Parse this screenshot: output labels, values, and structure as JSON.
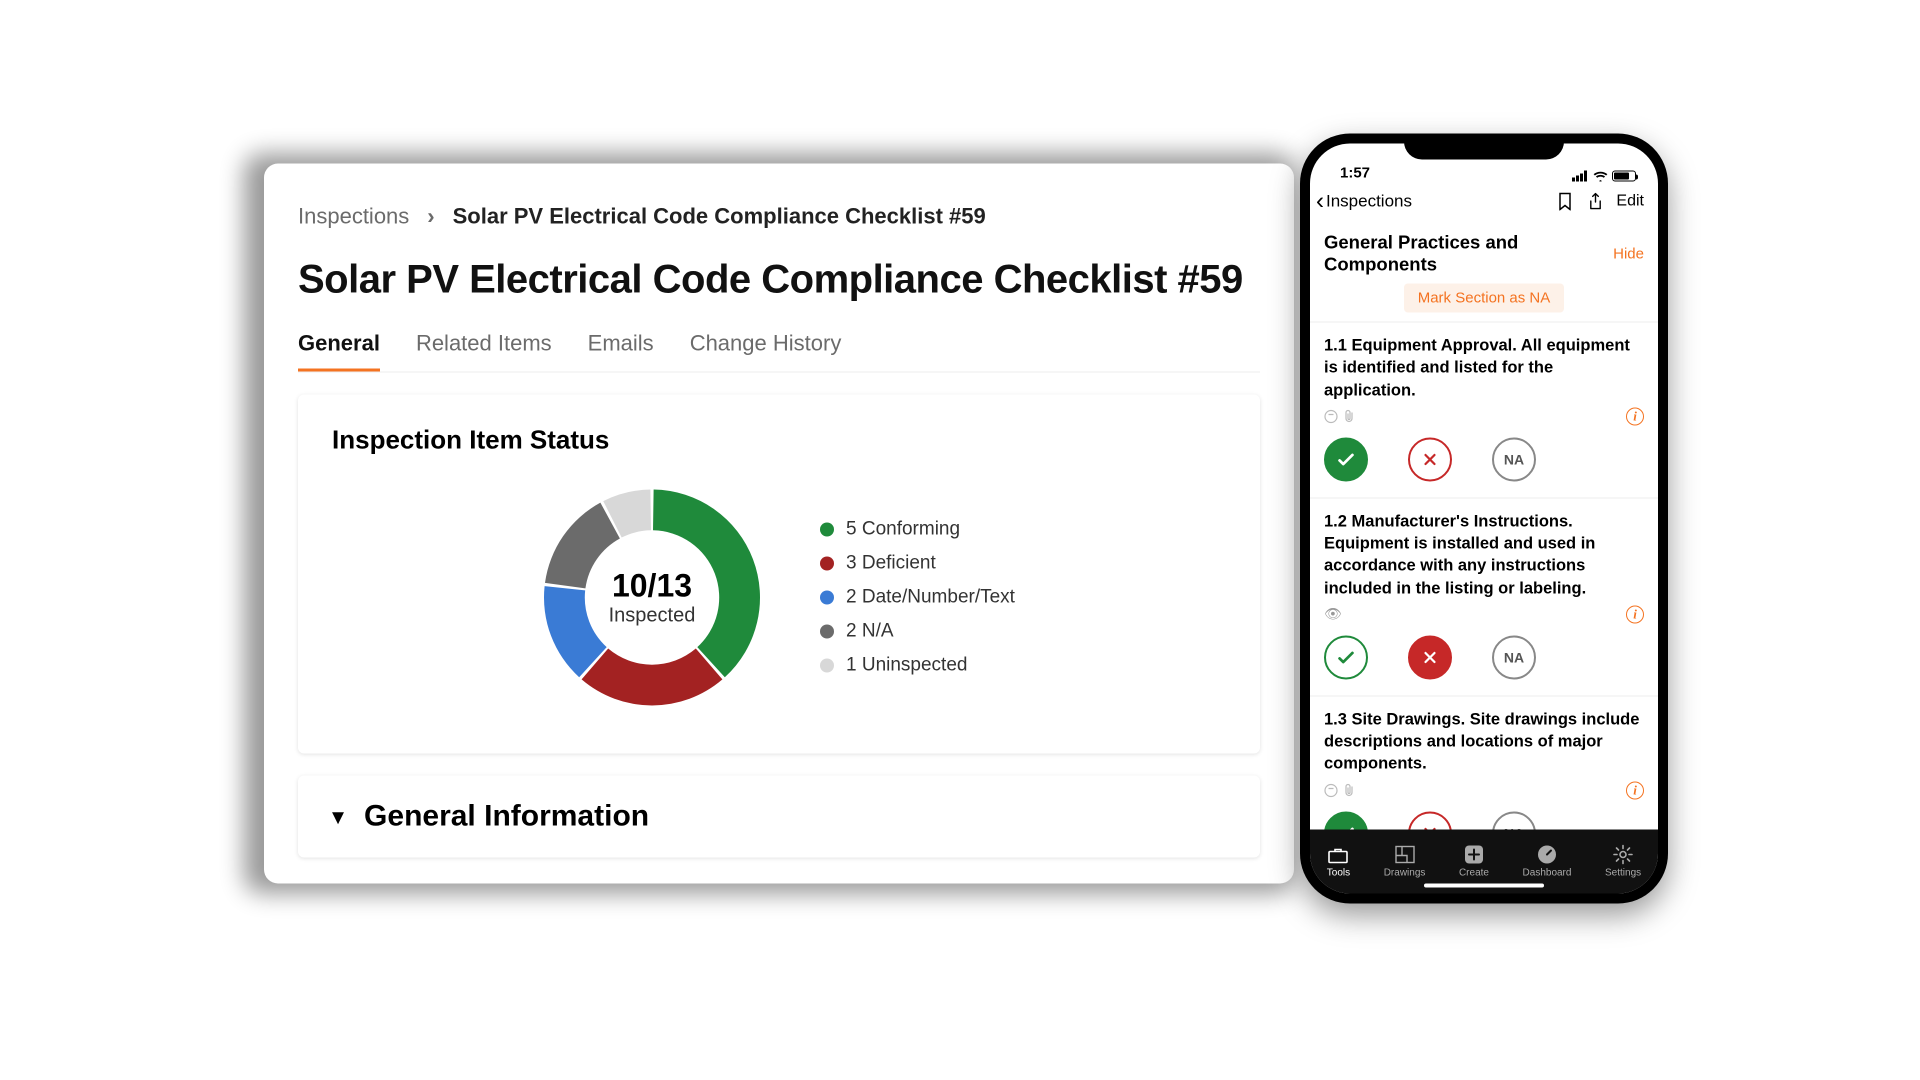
{
  "desktop": {
    "breadcrumb": {
      "root": "Inspections",
      "current": "Solar PV Electrical Code Compliance Checklist #59"
    },
    "title": "Solar PV Electrical Code Compliance Checklist #59",
    "tabs": [
      "General",
      "Related Items",
      "Emails",
      "Change History"
    ],
    "active_tab": 0,
    "status_card": {
      "title": "Inspection Item Status",
      "center_value": "10/13",
      "center_label": "Inspected",
      "legend": [
        {
          "count": 5,
          "label": "Conforming",
          "color": "#1f8a3b"
        },
        {
          "count": 3,
          "label": "Deficient",
          "color": "#a32222"
        },
        {
          "count": 2,
          "label": "Date/Number/Text",
          "color": "#3a7bd5"
        },
        {
          "count": 2,
          "label": "N/A",
          "color": "#6b6b6b"
        },
        {
          "count": 1,
          "label": "Uninspected",
          "color": "#d8d8d8"
        }
      ]
    },
    "info_card_title": "General Information"
  },
  "phone": {
    "time": "1:57",
    "back_label": "Inspections",
    "edit": "Edit",
    "section_title": "General Practices and Components",
    "hide": "Hide",
    "mark_na": "Mark Section as NA",
    "na_label": "NA",
    "items": [
      {
        "text": "1.1 Equipment Approval. All equipment is identified and listed for the application.",
        "selected": "pass",
        "observed": false
      },
      {
        "text": "1.2 Manufacturer's Instructions. Equipment is installed and used in accordance with any instructions included in the listing or labeling.",
        "selected": "fail",
        "observed": true
      },
      {
        "text": "1.3 Site Drawings. Site drawings include descriptions and locations of major components.",
        "selected": "pass",
        "observed": false
      }
    ],
    "tabbar": [
      {
        "label": "Tools",
        "icon": "tools",
        "active": true
      },
      {
        "label": "Drawings",
        "icon": "drawings",
        "active": false
      },
      {
        "label": "Create",
        "icon": "create",
        "active": false
      },
      {
        "label": "Dashboard",
        "icon": "dashboard",
        "active": false
      },
      {
        "label": "Settings",
        "icon": "settings",
        "active": false
      }
    ]
  },
  "chart_data": {
    "type": "pie",
    "title": "Inspection Item Status",
    "categories": [
      "Conforming",
      "Deficient",
      "Date/Number/Text",
      "N/A",
      "Uninspected"
    ],
    "values": [
      5,
      3,
      2,
      2,
      1
    ],
    "colors": [
      "#1f8a3b",
      "#a32222",
      "#3a7bd5",
      "#6b6b6b",
      "#d8d8d8"
    ],
    "center_text": "10/13 Inspected",
    "total": 13
  }
}
